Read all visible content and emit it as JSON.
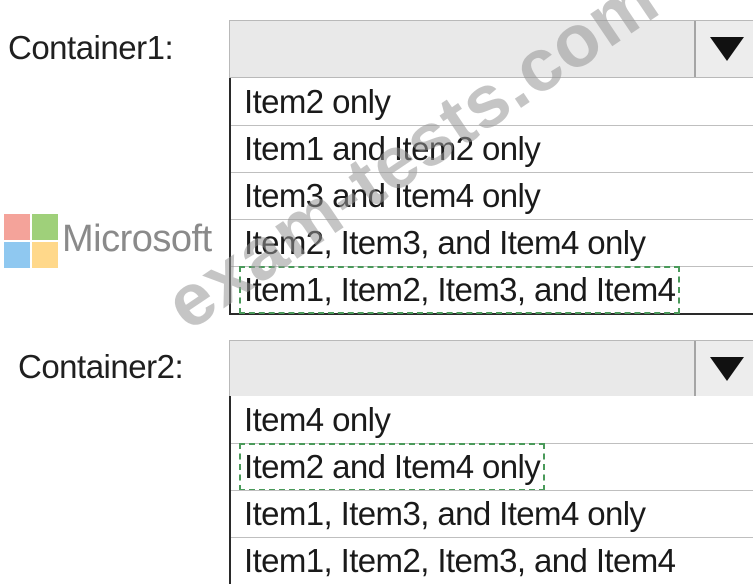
{
  "container1": {
    "label": "Container1:",
    "selected_value": "",
    "options": [
      "Item2 only",
      "Item1 and Item2 only",
      "Item3 and Item4 only",
      "Item2, Item3, and Item4 only",
      "Item1, Item2, Item3, and Item4"
    ],
    "highlighted_option_index": 4
  },
  "container2": {
    "label": "Container2:",
    "selected_value": "",
    "options": [
      "Item4 only",
      "Item2 and Item4 only",
      "Item1, Item3, and Item4 only",
      "Item1, Item2, Item3, and Item4"
    ],
    "highlighted_option_index": 1
  },
  "watermark": {
    "logo_icon": "microsoft-logo-icon",
    "logo_colors": [
      "#f25022",
      "#7fba00",
      "#00a4ef",
      "#ffb900"
    ],
    "brand_text": "Microsoft",
    "site_text": "exam-tests.com"
  },
  "colors": {
    "dropdown_background": "#e9e9e9",
    "answer_outline": "#4a9a5a"
  }
}
